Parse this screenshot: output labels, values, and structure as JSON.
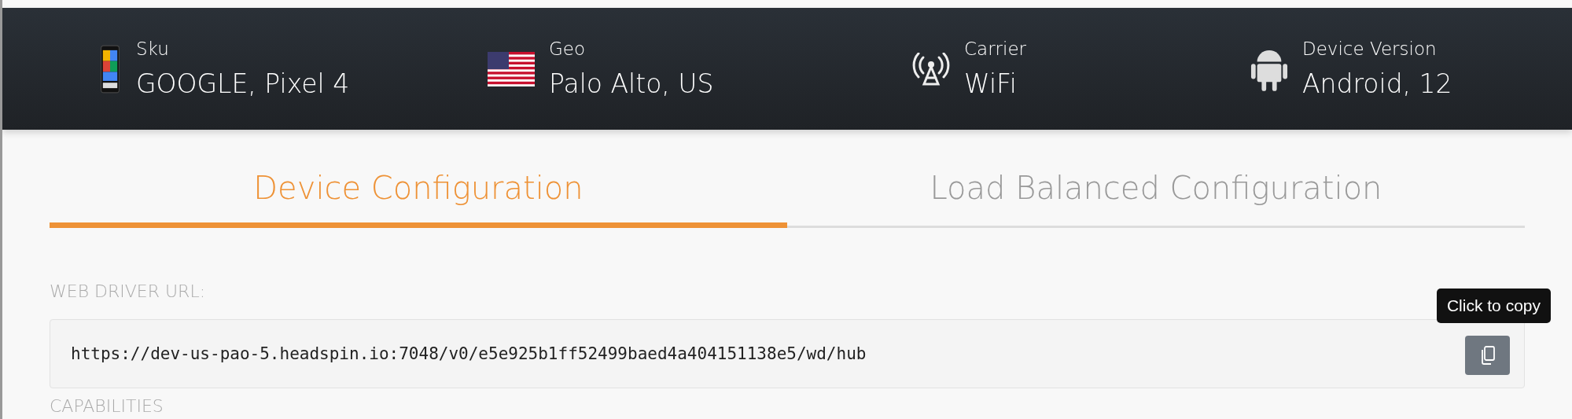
{
  "device_bar": {
    "items": [
      {
        "kind": "phone",
        "label": "Sku",
        "value": "GOOGLE, Pixel 4"
      },
      {
        "kind": "flag",
        "label": "Geo",
        "value": "Palo Alto, US"
      },
      {
        "kind": "antenna",
        "label": "Carrier",
        "value": "WiFi"
      },
      {
        "kind": "android",
        "label": "Device Version",
        "value": "Android, 12"
      }
    ]
  },
  "tabs": [
    {
      "label": "Device Configuration",
      "selected": true
    },
    {
      "label": "Load Balanced Configuration",
      "selected": false
    }
  ],
  "web_driver": {
    "label": "WEB DRIVER URL:",
    "url": "https://dev-us-pao-5.headspin.io:7048/v0/e5e925b1ff52499baed4a404151138e5/wd/hub",
    "tooltip": "Click to copy"
  },
  "capabilities": {
    "label": "CAPABILITIES"
  }
}
